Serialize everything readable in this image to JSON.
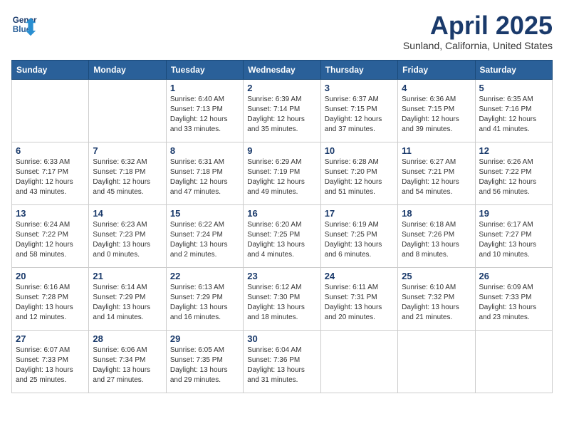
{
  "header": {
    "logo_line1": "General",
    "logo_line2": "Blue",
    "month_year": "April 2025",
    "location": "Sunland, California, United States"
  },
  "weekdays": [
    "Sunday",
    "Monday",
    "Tuesday",
    "Wednesday",
    "Thursday",
    "Friday",
    "Saturday"
  ],
  "weeks": [
    [
      {
        "day": "",
        "sunrise": "",
        "sunset": "",
        "daylight": ""
      },
      {
        "day": "",
        "sunrise": "",
        "sunset": "",
        "daylight": ""
      },
      {
        "day": "1",
        "sunrise": "Sunrise: 6:40 AM",
        "sunset": "Sunset: 7:13 PM",
        "daylight": "Daylight: 12 hours and 33 minutes."
      },
      {
        "day": "2",
        "sunrise": "Sunrise: 6:39 AM",
        "sunset": "Sunset: 7:14 PM",
        "daylight": "Daylight: 12 hours and 35 minutes."
      },
      {
        "day": "3",
        "sunrise": "Sunrise: 6:37 AM",
        "sunset": "Sunset: 7:15 PM",
        "daylight": "Daylight: 12 hours and 37 minutes."
      },
      {
        "day": "4",
        "sunrise": "Sunrise: 6:36 AM",
        "sunset": "Sunset: 7:15 PM",
        "daylight": "Daylight: 12 hours and 39 minutes."
      },
      {
        "day": "5",
        "sunrise": "Sunrise: 6:35 AM",
        "sunset": "Sunset: 7:16 PM",
        "daylight": "Daylight: 12 hours and 41 minutes."
      }
    ],
    [
      {
        "day": "6",
        "sunrise": "Sunrise: 6:33 AM",
        "sunset": "Sunset: 7:17 PM",
        "daylight": "Daylight: 12 hours and 43 minutes."
      },
      {
        "day": "7",
        "sunrise": "Sunrise: 6:32 AM",
        "sunset": "Sunset: 7:18 PM",
        "daylight": "Daylight: 12 hours and 45 minutes."
      },
      {
        "day": "8",
        "sunrise": "Sunrise: 6:31 AM",
        "sunset": "Sunset: 7:18 PM",
        "daylight": "Daylight: 12 hours and 47 minutes."
      },
      {
        "day": "9",
        "sunrise": "Sunrise: 6:29 AM",
        "sunset": "Sunset: 7:19 PM",
        "daylight": "Daylight: 12 hours and 49 minutes."
      },
      {
        "day": "10",
        "sunrise": "Sunrise: 6:28 AM",
        "sunset": "Sunset: 7:20 PM",
        "daylight": "Daylight: 12 hours and 51 minutes."
      },
      {
        "day": "11",
        "sunrise": "Sunrise: 6:27 AM",
        "sunset": "Sunset: 7:21 PM",
        "daylight": "Daylight: 12 hours and 54 minutes."
      },
      {
        "day": "12",
        "sunrise": "Sunrise: 6:26 AM",
        "sunset": "Sunset: 7:22 PM",
        "daylight": "Daylight: 12 hours and 56 minutes."
      }
    ],
    [
      {
        "day": "13",
        "sunrise": "Sunrise: 6:24 AM",
        "sunset": "Sunset: 7:22 PM",
        "daylight": "Daylight: 12 hours and 58 minutes."
      },
      {
        "day": "14",
        "sunrise": "Sunrise: 6:23 AM",
        "sunset": "Sunset: 7:23 PM",
        "daylight": "Daylight: 13 hours and 0 minutes."
      },
      {
        "day": "15",
        "sunrise": "Sunrise: 6:22 AM",
        "sunset": "Sunset: 7:24 PM",
        "daylight": "Daylight: 13 hours and 2 minutes."
      },
      {
        "day": "16",
        "sunrise": "Sunrise: 6:20 AM",
        "sunset": "Sunset: 7:25 PM",
        "daylight": "Daylight: 13 hours and 4 minutes."
      },
      {
        "day": "17",
        "sunrise": "Sunrise: 6:19 AM",
        "sunset": "Sunset: 7:25 PM",
        "daylight": "Daylight: 13 hours and 6 minutes."
      },
      {
        "day": "18",
        "sunrise": "Sunrise: 6:18 AM",
        "sunset": "Sunset: 7:26 PM",
        "daylight": "Daylight: 13 hours and 8 minutes."
      },
      {
        "day": "19",
        "sunrise": "Sunrise: 6:17 AM",
        "sunset": "Sunset: 7:27 PM",
        "daylight": "Daylight: 13 hours and 10 minutes."
      }
    ],
    [
      {
        "day": "20",
        "sunrise": "Sunrise: 6:16 AM",
        "sunset": "Sunset: 7:28 PM",
        "daylight": "Daylight: 13 hours and 12 minutes."
      },
      {
        "day": "21",
        "sunrise": "Sunrise: 6:14 AM",
        "sunset": "Sunset: 7:29 PM",
        "daylight": "Daylight: 13 hours and 14 minutes."
      },
      {
        "day": "22",
        "sunrise": "Sunrise: 6:13 AM",
        "sunset": "Sunset: 7:29 PM",
        "daylight": "Daylight: 13 hours and 16 minutes."
      },
      {
        "day": "23",
        "sunrise": "Sunrise: 6:12 AM",
        "sunset": "Sunset: 7:30 PM",
        "daylight": "Daylight: 13 hours and 18 minutes."
      },
      {
        "day": "24",
        "sunrise": "Sunrise: 6:11 AM",
        "sunset": "Sunset: 7:31 PM",
        "daylight": "Daylight: 13 hours and 20 minutes."
      },
      {
        "day": "25",
        "sunrise": "Sunrise: 6:10 AM",
        "sunset": "Sunset: 7:32 PM",
        "daylight": "Daylight: 13 hours and 21 minutes."
      },
      {
        "day": "26",
        "sunrise": "Sunrise: 6:09 AM",
        "sunset": "Sunset: 7:33 PM",
        "daylight": "Daylight: 13 hours and 23 minutes."
      }
    ],
    [
      {
        "day": "27",
        "sunrise": "Sunrise: 6:07 AM",
        "sunset": "Sunset: 7:33 PM",
        "daylight": "Daylight: 13 hours and 25 minutes."
      },
      {
        "day": "28",
        "sunrise": "Sunrise: 6:06 AM",
        "sunset": "Sunset: 7:34 PM",
        "daylight": "Daylight: 13 hours and 27 minutes."
      },
      {
        "day": "29",
        "sunrise": "Sunrise: 6:05 AM",
        "sunset": "Sunset: 7:35 PM",
        "daylight": "Daylight: 13 hours and 29 minutes."
      },
      {
        "day": "30",
        "sunrise": "Sunrise: 6:04 AM",
        "sunset": "Sunset: 7:36 PM",
        "daylight": "Daylight: 13 hours and 31 minutes."
      },
      {
        "day": "",
        "sunrise": "",
        "sunset": "",
        "daylight": ""
      },
      {
        "day": "",
        "sunrise": "",
        "sunset": "",
        "daylight": ""
      },
      {
        "day": "",
        "sunrise": "",
        "sunset": "",
        "daylight": ""
      }
    ]
  ]
}
